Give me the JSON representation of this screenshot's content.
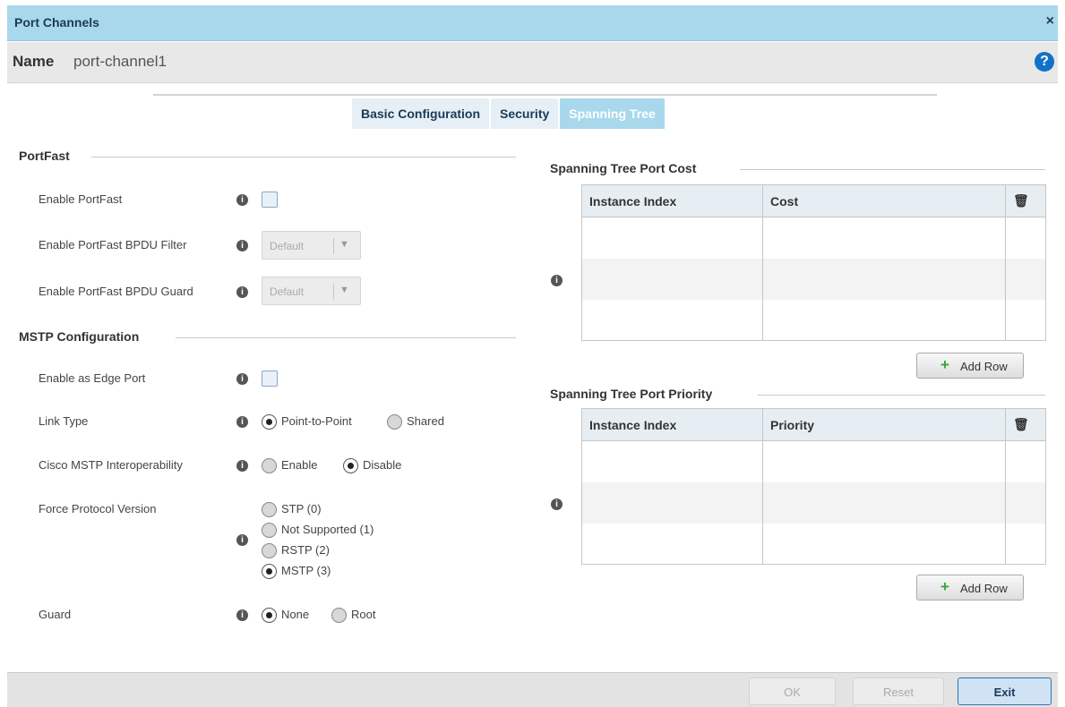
{
  "dialog": {
    "title": "Port Channels",
    "close_glyph": "×",
    "help_glyph": "?",
    "name_label": "Name",
    "name_value": "port-channel1"
  },
  "tabs": [
    {
      "label": "Basic Configuration",
      "active": false
    },
    {
      "label": "Security",
      "active": false
    },
    {
      "label": "Spanning Tree",
      "active": true
    }
  ],
  "portfast": {
    "section_title": "PortFast",
    "enable_portfast_label": "Enable PortFast",
    "enable_portfast_checked": false,
    "bpdu_filter_label": "Enable PortFast BPDU Filter",
    "bpdu_filter_value": "Default",
    "bpdu_guard_label": "Enable PortFast BPDU Guard",
    "bpdu_guard_value": "Default"
  },
  "mstp": {
    "section_title": "MSTP Configuration",
    "edge_port_label": "Enable as Edge Port",
    "edge_port_checked": false,
    "link_type_label": "Link Type",
    "link_type_options": [
      "Point-to-Point",
      "Shared"
    ],
    "link_type_selected": "Point-to-Point",
    "cisco_label": "Cisco MSTP Interoperability",
    "cisco_options": [
      "Enable",
      "Disable"
    ],
    "cisco_selected": "Disable",
    "force_label": "Force Protocol Version",
    "force_options": [
      "STP (0)",
      "Not Supported (1)",
      "RSTP (2)",
      "MSTP (3)"
    ],
    "force_selected": "MSTP (3)",
    "guard_label": "Guard",
    "guard_options": [
      "None",
      "Root"
    ],
    "guard_selected": "None"
  },
  "port_cost": {
    "section_title": "Spanning Tree Port Cost",
    "columns": [
      "Instance Index",
      "Cost"
    ],
    "rows": [],
    "add_row_label": "Add Row"
  },
  "port_priority": {
    "section_title": "Spanning Tree Port Priority",
    "columns": [
      "Instance Index",
      "Priority"
    ],
    "rows": [],
    "add_row_label": "Add Row"
  },
  "icons": {
    "info": "i",
    "trash": "🗑",
    "plus": "+",
    "dropdown": "▼"
  },
  "footer": {
    "ok_label": "OK",
    "reset_label": "Reset",
    "exit_label": "Exit"
  }
}
